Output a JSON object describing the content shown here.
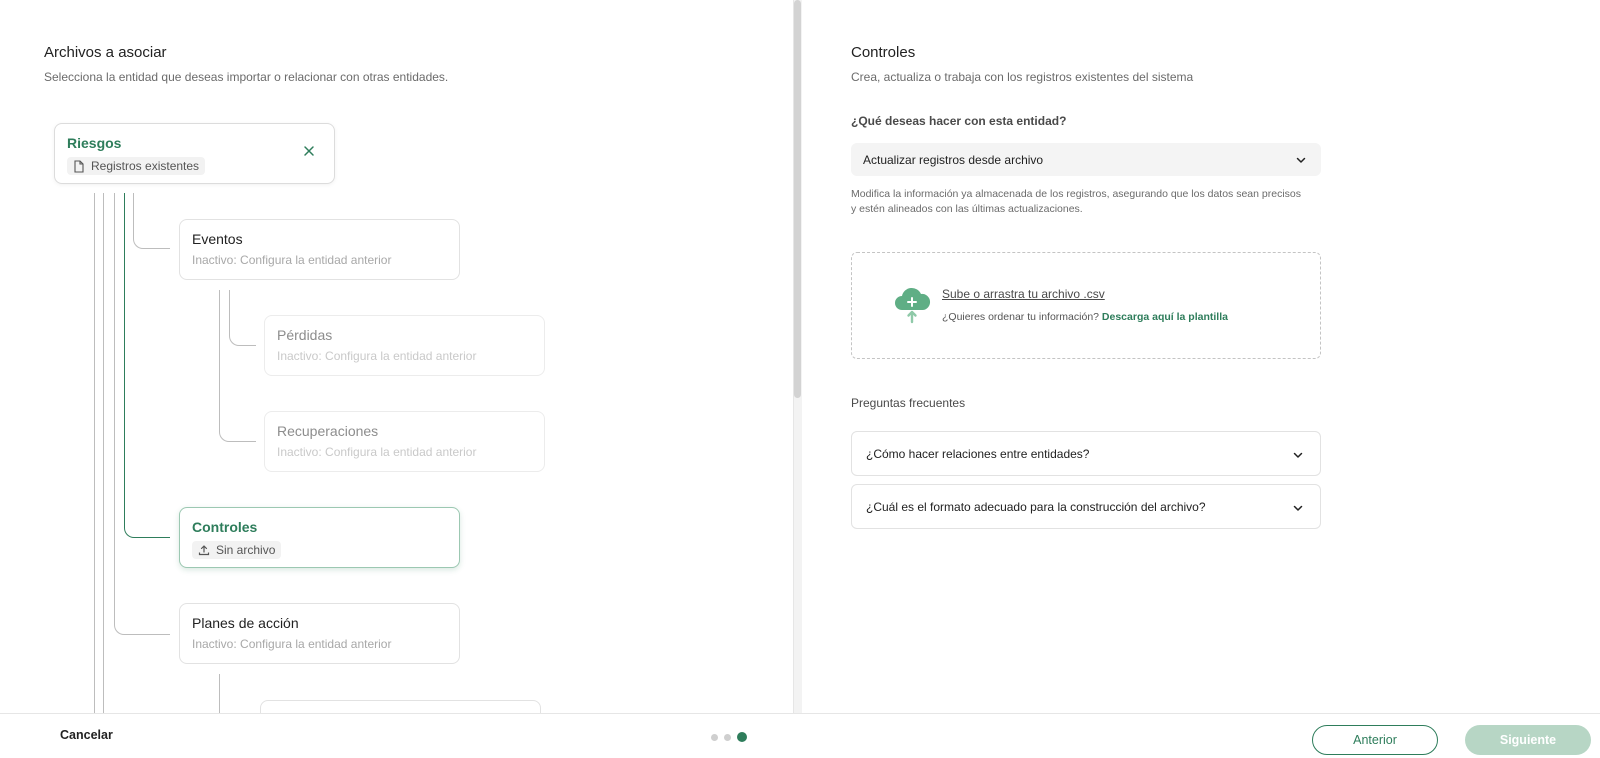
{
  "left": {
    "title": "Archivos a asociar",
    "subtitle": "Selecciona la entidad que deseas importar o relacionar con otras entidades."
  },
  "tree": {
    "root": {
      "name": "Riesgos",
      "chip": "Registros existentes",
      "chip_icon": "document-icon",
      "close_icon": "close-icon"
    },
    "eventos": {
      "name": "Eventos",
      "status": "Inactivo: Configura la entidad anterior"
    },
    "perdidas": {
      "name": "Pérdidas",
      "status": "Inactivo: Configura la entidad anterior"
    },
    "recuperaciones": {
      "name": "Recuperaciones",
      "status": "Inactivo: Configura la entidad anterior"
    },
    "controles": {
      "name": "Controles",
      "chip": "Sin archivo",
      "chip_icon": "upload-icon"
    },
    "planes": {
      "name": "Planes de acción",
      "status": "Inactivo: Configura la entidad anterior"
    }
  },
  "right": {
    "title": "Controles",
    "subtitle": "Crea, actualiza o trabaja con los registros existentes del sistema",
    "question_label": "¿Qué deseas hacer con esta entidad?",
    "select_value": "Actualizar registros desde archivo",
    "helper_line1": "Modifica la información ya almacenada de los registros, asegurando que los datos sean precisos",
    "helper_line2": "y estén alineados con las últimas actualizaciones.",
    "upload_link": "Sube o arrastra tu archivo .csv",
    "upload_hint": "¿Quieres ordenar tu información?",
    "template_link": "Descarga aquí la plantilla",
    "faq_title": "Preguntas frecuentes",
    "faq": [
      "¿Cómo hacer relaciones entre entidades?",
      "¿Cuál es el formato adecuado para la construcción del archivo?"
    ]
  },
  "footer": {
    "cancel": "Cancelar",
    "previous": "Anterior",
    "next": "Siguiente",
    "steps_total": 3,
    "current_step": 3
  },
  "colors": {
    "accent": "#2e7d5b",
    "accent_disabled": "#b7d6c5",
    "cloud_icon": "#5fae85"
  }
}
